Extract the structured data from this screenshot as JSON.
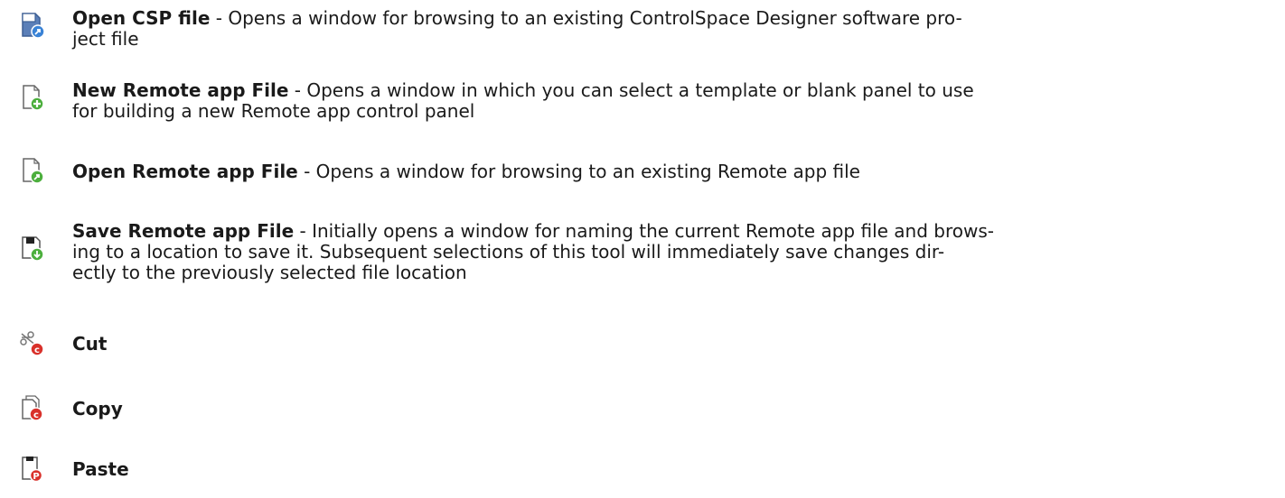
{
  "items": [
    {
      "icon": "open-csp-file-icon",
      "title": "Open CSP file",
      "desc_lines": [
        " - Opens a window for browsing to an existing ControlSpace Designer software pro-",
        "ject file"
      ]
    },
    {
      "icon": "new-remote-app-file-icon",
      "title": "New Remote app File",
      "desc_lines": [
        " - Opens a window in which you can select a template or blank panel to use",
        "for building a new Remote app control panel"
      ]
    },
    {
      "icon": "open-remote-app-file-icon",
      "title": "Open Remote app File",
      "desc_lines": [
        " - Opens a window for browsing to an existing Remote app file"
      ]
    },
    {
      "icon": "save-remote-app-file-icon",
      "title": "Save Remote app File",
      "desc_lines": [
        " - Initially opens a window for naming the current Remote app file and brows-",
        "ing to a location to save it. Subsequent selections of this tool will immediately save changes dir-",
        "ectly to the previously selected file location"
      ]
    },
    {
      "icon": "cut-icon",
      "title": "Cut",
      "desc_lines": []
    },
    {
      "icon": "copy-icon",
      "title": "Copy",
      "desc_lines": []
    },
    {
      "icon": "paste-icon",
      "title": "Paste",
      "desc_lines": []
    }
  ]
}
